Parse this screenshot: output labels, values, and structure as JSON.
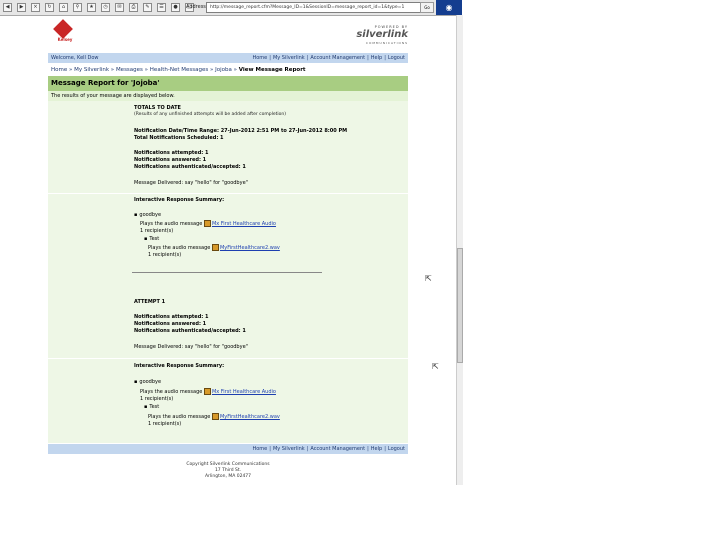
{
  "browser": {
    "address_label": "Address",
    "url": "http://message_report.cfm?Message_ID=1&SessionID=message_report_id=1&type=1",
    "go_label": "Go"
  },
  "brand": {
    "logo_text": "Kelsey",
    "powered": "POWERED BY",
    "name": "silverlink",
    "sub": "COMMUNICATIONS"
  },
  "userbar": {
    "welcome": "Welcome, Kell Dow",
    "links": [
      "Home",
      "My Silverlink",
      "Account Management",
      "Help",
      "Logout"
    ]
  },
  "breadcrumb": {
    "items": [
      "Home",
      "My Silverlink",
      "Messages",
      "Health-Net Messages",
      "Jojoba"
    ],
    "current": "View Message Report"
  },
  "report": {
    "title": "Message Report for 'Jojoba'",
    "results_note": "The results of your message are displayed below."
  },
  "summary": {
    "heading": "TOTALS TO DATE",
    "note": "(Results of any unfinished attempts will be added after completion)",
    "datetime": "Notification Date/Time Range: 27-Jun-2012 2:51 PM to 27-Jun-2012 8:00 PM",
    "total": "Total Notifications Scheduled: 1",
    "attempted": "Notifications attempted: 1",
    "answered": "Notifications answered: 1",
    "authenticated": "Notifications authenticated/accepted: 1",
    "delivered": "Message Delivered: say \"hello\" for \"goodbye\"",
    "irs_heading": "Interactive Response Summary:",
    "irs_item": "goodbye",
    "play1": "Plays the audio message",
    "audio1": "Mx First Healthcare Audio",
    "rec1": "1 recipient(s)",
    "sub_item": "Test",
    "play2": "Plays the audio message",
    "audio2": "MyFirstHealthcare2.wav",
    "rec2": "1 recipient(s)"
  },
  "attempt": {
    "heading": "ATTEMPT 1",
    "attempted": "Notifications attempted: 1",
    "answered": "Notifications answered: 1",
    "authenticated": "Notifications authenticated/accepted: 1",
    "delivered": "Message Delivered: say \"hello\" for \"goodbye\"",
    "irs_heading": "Interactive Response Summary:",
    "irs_item": "goodbye",
    "play1": "Plays the audio message",
    "audio1": "Mx First Healthcare Audio",
    "rec1": "1 recipient(s)",
    "sub_item": "Test",
    "play2": "Plays the audio message",
    "audio2": "MyFirstHealthcare2.wav",
    "rec2": "1 recipient(s)"
  },
  "footer": {
    "links": [
      "Home",
      "My Silverlink",
      "Account Management",
      "Help",
      "Logout"
    ],
    "copyright": "Copyright Silverlink Communications",
    "address1": "17 Third St.",
    "address2": "Arlington, MA 02477"
  }
}
